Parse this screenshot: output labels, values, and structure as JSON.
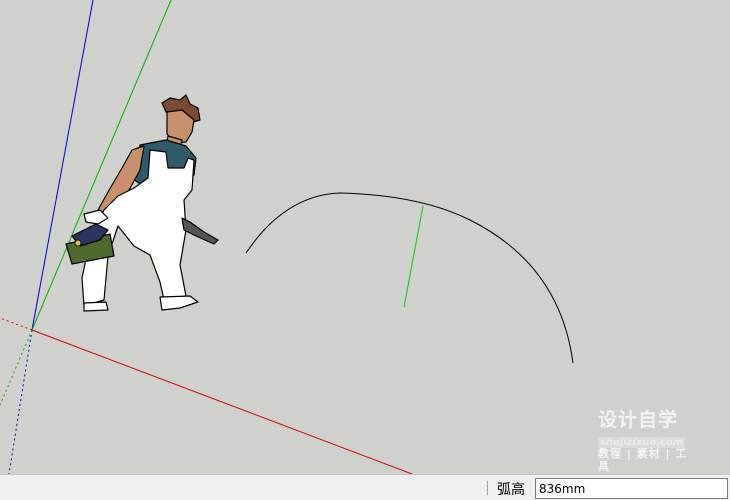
{
  "viewport": {
    "background_color": "#d0d0cc",
    "axis_colors": {
      "red": "#d00000",
      "green": "#00c000",
      "blue": "#0000d0"
    },
    "arc_color": "#000000",
    "arc_tangent_color": "#22cc22",
    "scale_figure": "person-figure"
  },
  "watermark": {
    "title": "设计自学",
    "url": "shejizixue.com",
    "subtitle": "教程 | 素材 | 工具"
  },
  "statusbar": {
    "measure_label": "弧高",
    "measure_value": "836mm"
  }
}
